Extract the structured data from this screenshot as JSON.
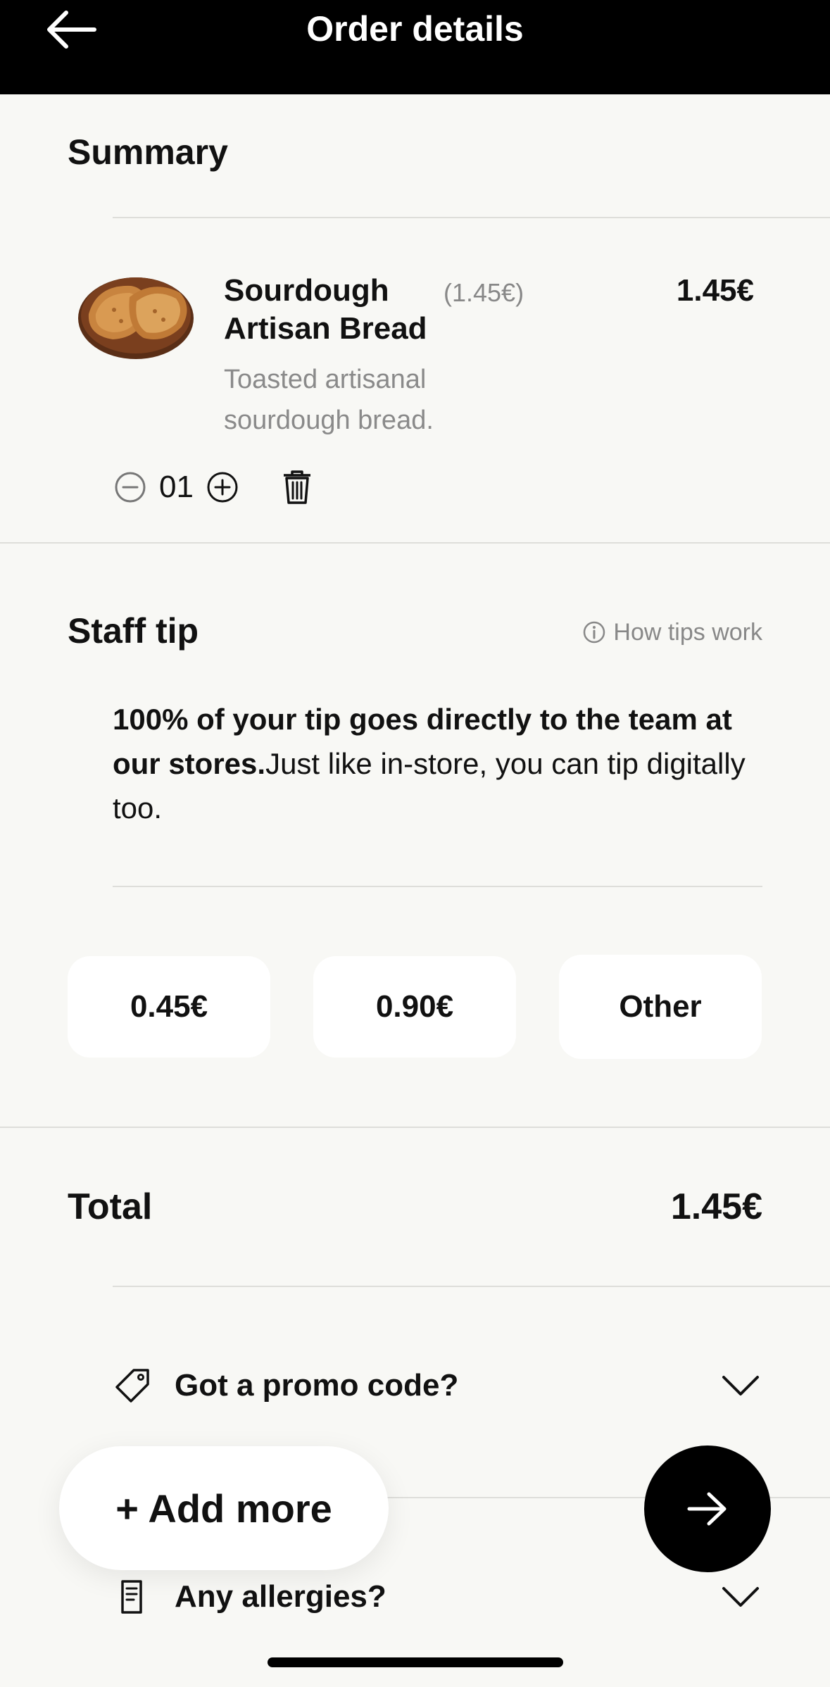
{
  "header": {
    "title": "Order details"
  },
  "summary": {
    "title": "Summary",
    "item": {
      "name": "Sourdough Artisan Bread",
      "unit_price": "(1.45€)",
      "line_price": "1.45€",
      "description": "Toasted artisanal sourdough bread.",
      "quantity": "01"
    }
  },
  "tip": {
    "title": "Staff tip",
    "how_link": "How tips work",
    "text_bold": "100% of your tip goes directly to the team at our stores.",
    "text_regular": "Just like in-store, you can tip digitally too.",
    "options": [
      "0.45€",
      "0.90€",
      "Other"
    ]
  },
  "total": {
    "label": "Total",
    "value": "1.45€"
  },
  "promo": {
    "label": "Got a promo code?"
  },
  "allergies": {
    "label": "Any allergies?"
  },
  "actions": {
    "add_more": "+ Add more"
  },
  "colors": {
    "accent": "#000000",
    "background": "#f8f8f5",
    "muted": "#888888"
  }
}
